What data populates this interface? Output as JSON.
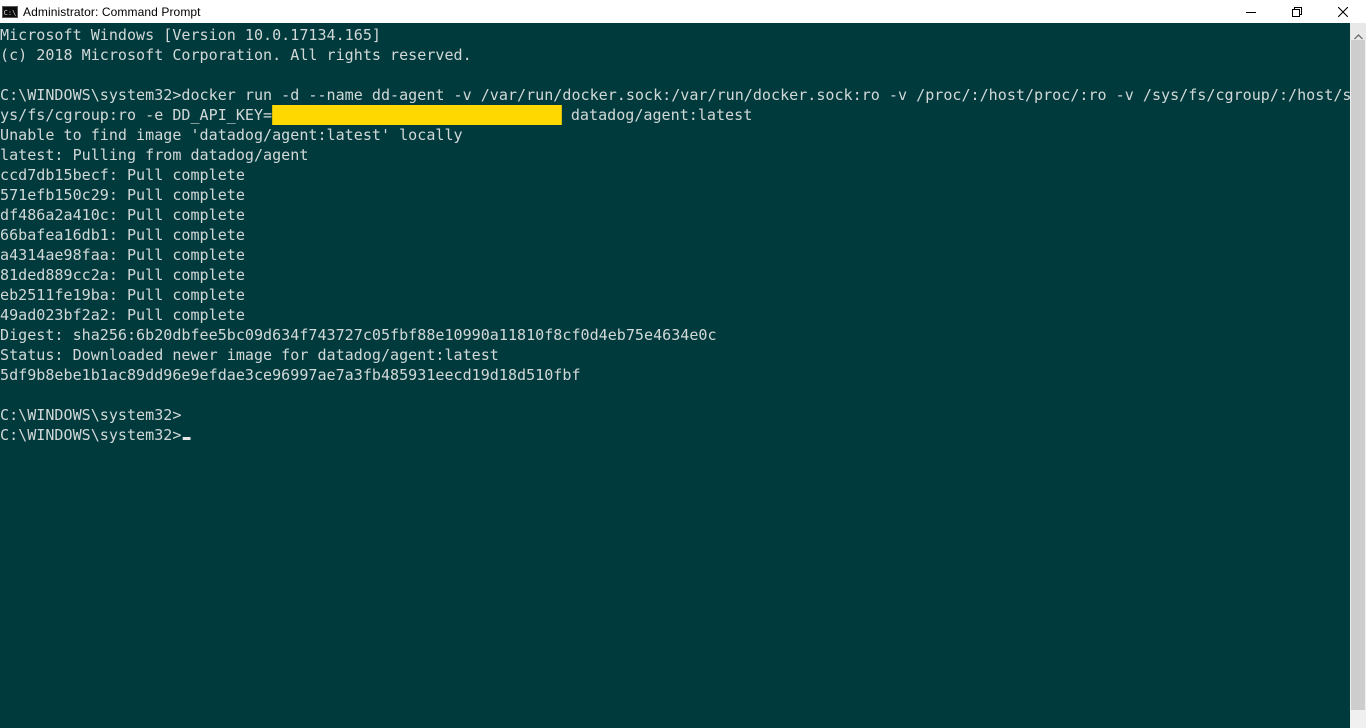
{
  "window": {
    "title": "Administrator: Command Prompt",
    "icon": "cmd-icon",
    "icon_text": "C:\\",
    "background_color": "#003a3c",
    "text_color": "#d2d8d8",
    "redaction_color": "#ffd800"
  },
  "caption_buttons": {
    "minimize_icon": "minimize-icon",
    "restore_icon": "restore-icon",
    "close_icon": "close-icon"
  },
  "console": {
    "lines": [
      "Microsoft Windows [Version 10.0.17134.165]",
      "(c) 2018 Microsoft Corporation. All rights reserved.",
      "",
      "C:\\WINDOWS\\system32>docker run -d --name dd-agent -v /var/run/docker.sock:/var/run/docker.sock:ro -v /proc/:/host/proc/:ro -v /sys/fs/cgroup/:/host/s",
      "",
      "Unable to find image 'datadog/agent:latest' locally",
      "latest: Pulling from datadog/agent",
      "ccd7db15becf: Pull complete",
      "571efb150c29: Pull complete",
      "df486a2a410c: Pull complete",
      "66bafea16db1: Pull complete",
      "a4314ae98faa: Pull complete",
      "81ded889cc2a: Pull complete",
      "eb2511fe19ba: Pull complete",
      "49ad023bf2a2: Pull complete",
      "Digest: sha256:6b20dbfee5bc09d634f743727c05fbf88e10990a11810f8cf0d4eb75e4634e0c",
      "Status: Downloaded newer image for datadog/agent:latest",
      "5df9b8ebe1b1ac89dd96e9efdae3ce96997ae7a3fb485931eecd19d18d510fbf",
      "",
      "C:\\WINDOWS\\system32>",
      "C:\\WINDOWS\\system32>"
    ],
    "wrapped_line_before_redaction": "ys/fs/cgroup:ro -e DD_API_KEY=",
    "wrapped_line_after_redaction": " datadog/agent:latest"
  },
  "scrollbar": {
    "up_arrow_icon": "scroll-up-arrow-icon"
  }
}
